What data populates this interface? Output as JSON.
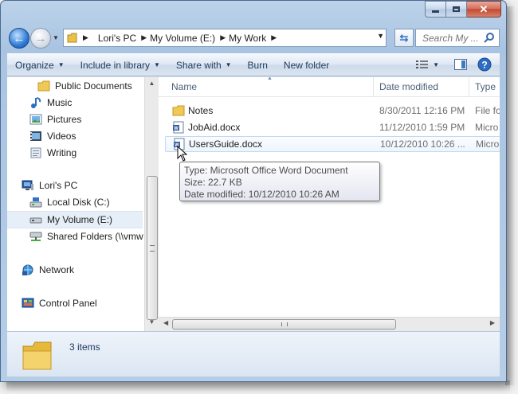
{
  "address": {
    "crumbs": [
      "Lori's PC",
      "My Volume (E:)",
      "My Work"
    ]
  },
  "search": {
    "placeholder": "Search My ..."
  },
  "toolbar": {
    "organize": "Organize",
    "include_in_library": "Include in library",
    "share_with": "Share with",
    "burn": "Burn",
    "new_folder": "New folder"
  },
  "nav": {
    "items": [
      {
        "label": "Public Documents",
        "icon": "folder-icon"
      },
      {
        "label": "Music",
        "icon": "music-icon"
      },
      {
        "label": "Pictures",
        "icon": "pictures-icon"
      },
      {
        "label": "Videos",
        "icon": "videos-icon"
      },
      {
        "label": "Writing",
        "icon": "library-icon"
      },
      {
        "label": "Lori's PC",
        "icon": "computer-icon"
      },
      {
        "label": "Local Disk (C:)",
        "icon": "drive-icon"
      },
      {
        "label": "My Volume (E:)",
        "icon": "drive-icon"
      },
      {
        "label": "Shared Folders (\\\\vmw",
        "icon": "network-drive-icon"
      },
      {
        "label": "Network",
        "icon": "network-icon"
      },
      {
        "label": "Control Panel",
        "icon": "control-panel-icon"
      }
    ]
  },
  "columns": {
    "name": "Name",
    "date": "Date modified",
    "type": "Type"
  },
  "files": [
    {
      "name": "Notes",
      "date": "8/30/2011 12:16 PM",
      "type": "File fo",
      "icon": "folder-icon"
    },
    {
      "name": "JobAid.docx",
      "date": "11/12/2010 1:59 PM",
      "type": "Micro",
      "icon": "word-doc-icon"
    },
    {
      "name": "UsersGuide.docx",
      "date": "10/12/2010 10:26 ...",
      "type": "Micro",
      "icon": "word-doc-icon"
    }
  ],
  "tooltip": {
    "type": "Type: Microsoft Office Word Document",
    "size": "Size: 22.7 KB",
    "date": "Date modified: 10/12/2010 10:26 AM"
  },
  "status": {
    "count": "3 items"
  },
  "colors": {
    "accent": "#1e395b",
    "selection": "#e6eef8",
    "close": "#c44630"
  }
}
